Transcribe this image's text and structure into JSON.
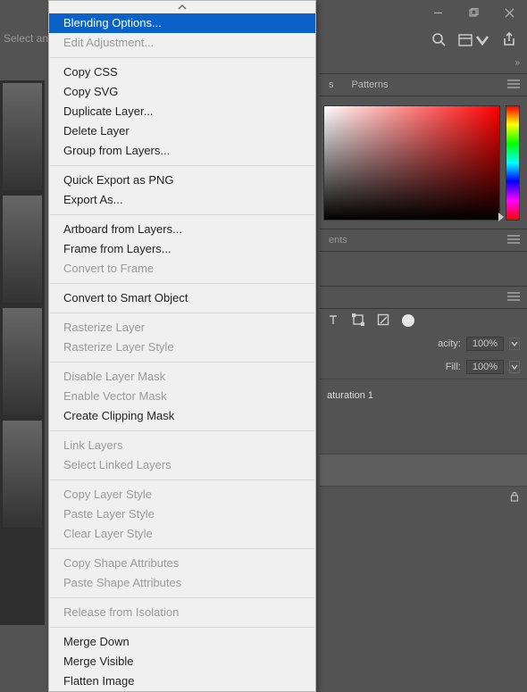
{
  "window": {
    "minimize": "–",
    "maximize": "❐",
    "close": "✕"
  },
  "left": {
    "select_and": "Select and"
  },
  "panels": {
    "chevron": "»",
    "color": {
      "tabs": [
        "s",
        "Patterns"
      ]
    },
    "mid": {
      "tabs": [
        "ents"
      ]
    },
    "layers": {
      "opacity_label_suffix": "acity:",
      "opacity_value": "100%",
      "fill_label": "Fill:",
      "fill_value": "100%",
      "layer_name_fragment": "aturation 1"
    }
  },
  "menu": {
    "items": [
      {
        "label": "Blending Options...",
        "state": "highlight"
      },
      {
        "label": "Edit Adjustment...",
        "state": "disabled"
      },
      {
        "sep": true
      },
      {
        "label": "Copy CSS"
      },
      {
        "label": "Copy SVG"
      },
      {
        "label": "Duplicate Layer..."
      },
      {
        "label": "Delete Layer"
      },
      {
        "label": "Group from Layers..."
      },
      {
        "sep": true
      },
      {
        "label": "Quick Export as PNG"
      },
      {
        "label": "Export As..."
      },
      {
        "sep": true
      },
      {
        "label": "Artboard from Layers..."
      },
      {
        "label": "Frame from Layers..."
      },
      {
        "label": "Convert to Frame",
        "state": "disabled"
      },
      {
        "sep": true
      },
      {
        "label": "Convert to Smart Object"
      },
      {
        "sep": true
      },
      {
        "label": "Rasterize Layer",
        "state": "disabled"
      },
      {
        "label": "Rasterize Layer Style",
        "state": "disabled"
      },
      {
        "sep": true
      },
      {
        "label": "Disable Layer Mask",
        "state": "disabled"
      },
      {
        "label": "Enable Vector Mask",
        "state": "disabled"
      },
      {
        "label": "Create Clipping Mask"
      },
      {
        "sep": true
      },
      {
        "label": "Link Layers",
        "state": "disabled"
      },
      {
        "label": "Select Linked Layers",
        "state": "disabled"
      },
      {
        "sep": true
      },
      {
        "label": "Copy Layer Style",
        "state": "disabled"
      },
      {
        "label": "Paste Layer Style",
        "state": "disabled"
      },
      {
        "label": "Clear Layer Style",
        "state": "disabled"
      },
      {
        "sep": true
      },
      {
        "label": "Copy Shape Attributes",
        "state": "disabled"
      },
      {
        "label": "Paste Shape Attributes",
        "state": "disabled"
      },
      {
        "sep": true
      },
      {
        "label": "Release from Isolation",
        "state": "disabled"
      },
      {
        "sep": true
      },
      {
        "label": "Merge Down"
      },
      {
        "label": "Merge Visible"
      },
      {
        "label": "Flatten Image"
      }
    ]
  }
}
